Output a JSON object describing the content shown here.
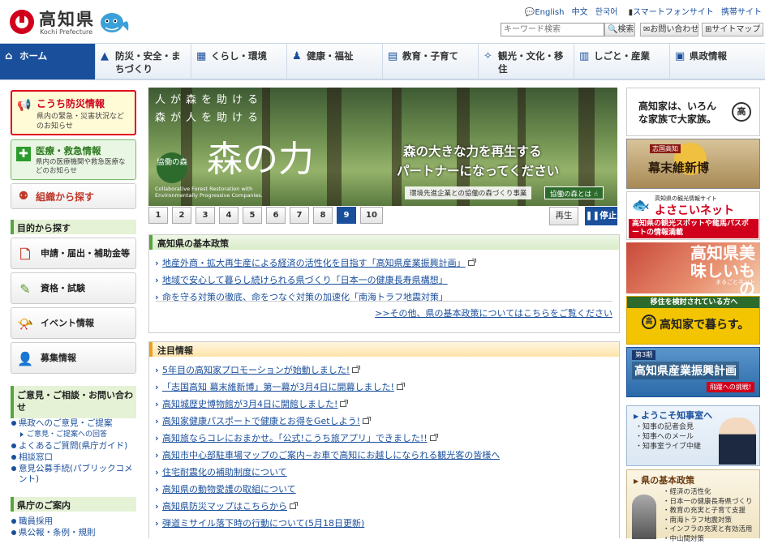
{
  "header": {
    "site_name": "高知県",
    "site_sub": "Kochi Prefecture",
    "top_links": [
      "English",
      "中文",
      "한국어",
      "スマートフォンサイト",
      "携帯サイト"
    ],
    "search_placeholder": "キーワード検索",
    "search_button": "検索",
    "contact": "お問い合わせ",
    "sitemap": "サイトマップ"
  },
  "gnav": [
    {
      "label": "ホーム"
    },
    {
      "label": "防災・安全・まちづくり"
    },
    {
      "label": "くらし・環境"
    },
    {
      "label": "健康・福祉"
    },
    {
      "label": "教育・子育て"
    },
    {
      "label": "観光・文化・移住"
    },
    {
      "label": "しごと・産業"
    },
    {
      "label": "県政情報"
    }
  ],
  "left": {
    "bousai_title": "こうち防災情報",
    "bousai_desc": "県内の緊急・災害状況などのお知らせ",
    "iryo_title": "医療・救急情報",
    "iryo_desc": "県内の医療機関や救急医療などのお知らせ",
    "soshiki": "組織から探す",
    "mokuteki_heading": "目的から探す",
    "mokuteki": [
      "申請・届出・補助金等",
      "資格・試験",
      "イベント情報",
      "募集情報"
    ],
    "goiken_heading": "ご意見・ご相談・お問い合わせ",
    "goiken_items": [
      "県政へのご意見・ご提案",
      "ご意見・ご提案への回答",
      "よくあるご質問(県庁ガイド)",
      "相談窓口",
      "意見公募手続(パブリックコメント)"
    ],
    "kencho_heading": "県庁のご案内",
    "kencho_items": [
      "職員採用",
      "県公報・条例・規則"
    ]
  },
  "banner": {
    "line1": "人が森を助ける",
    "line2": "森が人を助ける",
    "big": "森の力",
    "circle": "協働の森",
    "english": "Collaborative Forest Restoration with Environmentally Progressive Companies.",
    "copy1": "森の大きな力を再生する",
    "copy2": "パートナーになってください",
    "tag": "環境先進企業との協働の森づくり事業",
    "link": "協働の森とは"
  },
  "pager": {
    "pages": [
      "1",
      "2",
      "3",
      "4",
      "5",
      "6",
      "7",
      "8",
      "9",
      "10"
    ],
    "active": "9",
    "play": "再生",
    "pause": "停止"
  },
  "policy": {
    "heading": "高知県の基本政策",
    "items": [
      "地産外商・拡大再生産による経済の活性化を目指す「高知県産業振興計画」",
      "地域で安心して暮らし続けられる県づくり「日本一の健康長寿県構想」",
      "命を守る対策の徹底、命をつなぐ対策の加速化「南海トラフ地震対策」"
    ],
    "more": ">>その他、県の基本政策についてはこちらをご覧ください"
  },
  "notice": {
    "heading": "注目情報",
    "items": [
      "5年目の高知家プロモーションが始動しました!",
      "「志国高知 幕末維新博」第一幕が3月4日に開幕しました!",
      "高知城歴史博物館が3月4日に開館しました!",
      "高知家健康パスポートで健康とお得をGetしよう!",
      "高知旅ならコレにおまかせ。「公式!こうち旅アプリ」できました!!",
      "高知市中心部駐車場マップのご案内~お車で高知にお越しになられる観光客の皆様へ",
      "住宅耐震化の補助制度について",
      "高知県の動物愛護の取組について",
      "高知県防災マップはこちらから",
      "弾道ミサイル落下時の行動について(5月18日更新)"
    ]
  },
  "right": {
    "kochike": "高知家は、いろんな家族で大家族。",
    "kochike_mark": "高",
    "bakumatsu_small": "志国高知",
    "bakumatsu": "幕末維新博",
    "yosakoi_small": "高知県の観光情報サイト",
    "yosakoi": "よさこいネット",
    "yosakoi_desc": "高知県の観光スポットや龍馬パスポートの情報満載",
    "bimi": "高知県美味しいもの",
    "bimi_small": "まるごとネット",
    "iju_top": "移住を検討されている方へ",
    "iju": "高知家で暮らす。",
    "iju_mark": "高",
    "sangyo_small": "第3期",
    "sangyo": "高知県産業振興計画",
    "sangyo_tag": "飛躍への挑戦!",
    "governor_title": "ようこそ知事室へ",
    "governor_items": [
      "知事の記者会見",
      "知事へのメール",
      "知事室ライブ中継"
    ],
    "kihon_title": "県の基本政策",
    "kihon_items": [
      "経済の活性化",
      "日本一の健康長寿県づくり",
      "教育の充実と子育て支援",
      "南海トラフ地震対策",
      "インフラの充実と有効活用",
      "中山間対策"
    ]
  }
}
